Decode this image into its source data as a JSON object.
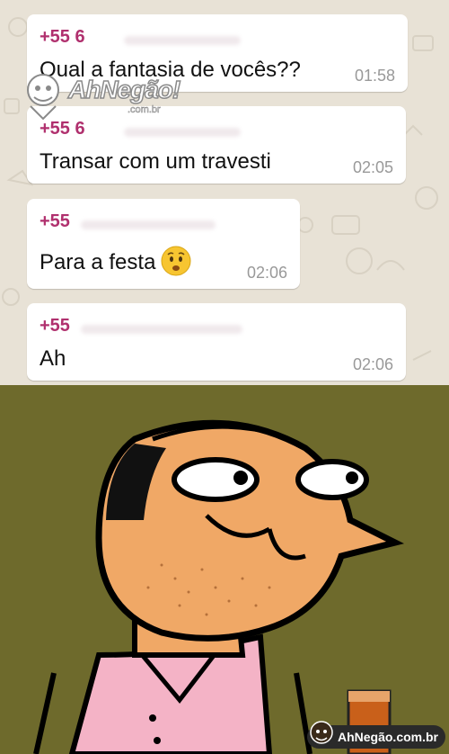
{
  "messages": [
    {
      "sender": "+55 6",
      "text": "Qual a fantasia de vocês??",
      "time": "01:58"
    },
    {
      "sender": "+55 6",
      "text": "Transar com um travesti",
      "time": "02:05"
    },
    {
      "sender": "+55",
      "text": "Para a festa",
      "emoji": "worried-face",
      "time": "02:06"
    },
    {
      "sender": "+55",
      "text": "Ah",
      "time": "02:06"
    }
  ],
  "watermark": {
    "brand": "AhNegão!",
    "sub": ".com.br",
    "footer": "AhNegão.com.br"
  },
  "colors": {
    "chat_bg": "#e8e2d6",
    "sender": "#b0306e",
    "cartoon_bg": "#6e6a2c",
    "skin": "#f0a866"
  }
}
